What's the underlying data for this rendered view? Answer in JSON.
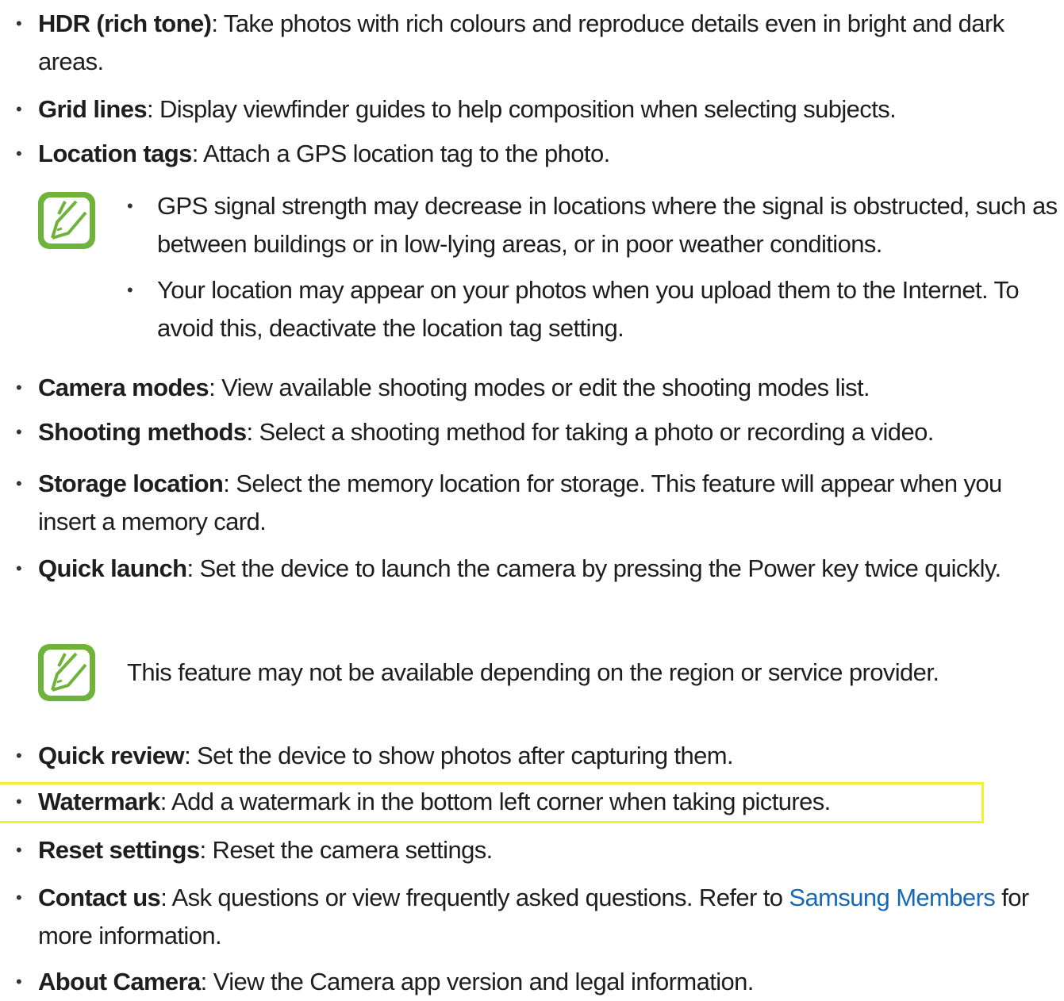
{
  "bullet_glyph": "•",
  "items_top": [
    {
      "term": "HDR (rich tone)",
      "text": ": Take photos with rich colours and reproduce details even in bright and dark areas."
    },
    {
      "term": "Grid lines",
      "text": ": Display viewfinder guides to help composition when selecting subjects."
    },
    {
      "term": "Location tags",
      "text": ": Attach a GPS location tag to the photo."
    }
  ],
  "note1": {
    "icon": "note-pencil-icon",
    "bullets": [
      "GPS signal strength may decrease in locations where the signal is obstructed, such as between buildings or in low-lying areas, or in poor weather conditions.",
      "Your location may appear on your photos when you upload them to the Internet. To avoid this, deactivate the location tag setting."
    ]
  },
  "items_mid": [
    {
      "term": "Camera modes",
      "text": ": View available shooting modes or edit the shooting modes list."
    },
    {
      "term": "Shooting methods",
      "text": ": Select a shooting method for taking a photo or recording a video."
    },
    {
      "term": "Storage location",
      "text": ": Select the memory location for storage. This feature will appear when you insert a memory card."
    },
    {
      "term": "Quick launch",
      "text": ": Set the device to launch the camera by pressing the Power key twice quickly."
    }
  ],
  "note2": {
    "icon": "note-pencil-icon",
    "text": "This feature may not be available depending on the region or service provider."
  },
  "items_bottom": [
    {
      "term": "Quick review",
      "text": ": Set the device to show photos after capturing them."
    },
    {
      "term": "Watermark",
      "text": ": Add a watermark in the bottom left corner when taking pictures."
    },
    {
      "term": "Reset settings",
      "text": ": Reset the camera settings."
    }
  ],
  "contact": {
    "term": "Contact us",
    "text_before": ": Ask questions or view frequently asked questions. Refer to ",
    "link": "Samsung Members",
    "text_after": " for more information."
  },
  "about": {
    "term": "About Camera",
    "text": ": View the Camera app version and legal information."
  },
  "colors": {
    "accent_green": "#6fb33b",
    "link_blue": "#1769b5",
    "highlight_yellow": "#f4f02a"
  }
}
